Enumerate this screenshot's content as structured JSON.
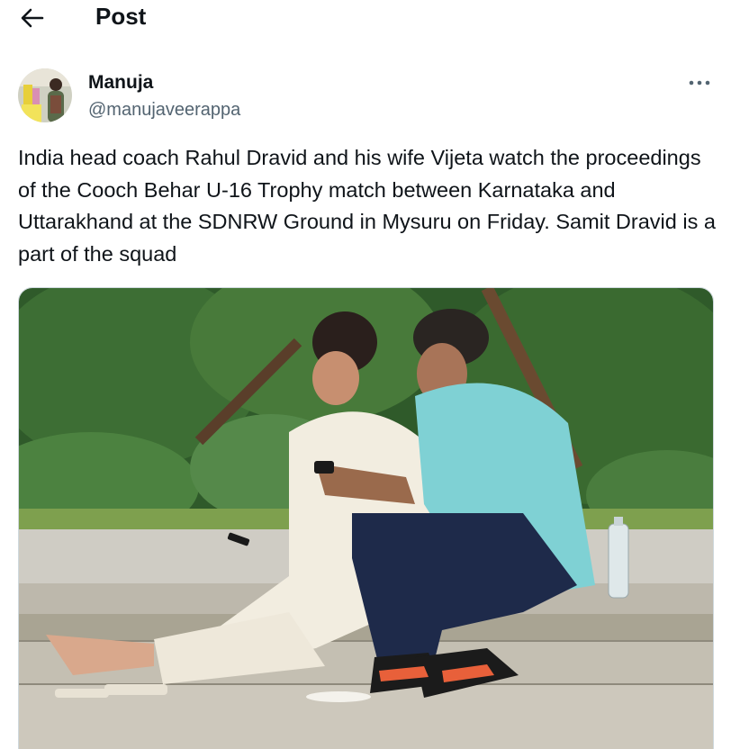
{
  "header": {
    "back_icon": "arrow-left-icon",
    "title": "Post"
  },
  "author": {
    "display_name": "Manuja",
    "handle": "@manujaveerappa",
    "avatar_icon": "user-avatar",
    "more_icon": "more-horizontal-icon"
  },
  "post": {
    "text": "India head coach Rahul Dravid and his wife Vijeta watch the proceedings of the Cooch Behar U-16 Trophy match between Karnataka and Uttarakhand at the SDNRW Ground in Mysuru on Friday. Samit Dravid is a part of the squad"
  },
  "media": {
    "type": "photo"
  },
  "colors": {
    "text_primary": "#0f1419",
    "text_secondary": "#536471",
    "border": "#cfd9de"
  }
}
